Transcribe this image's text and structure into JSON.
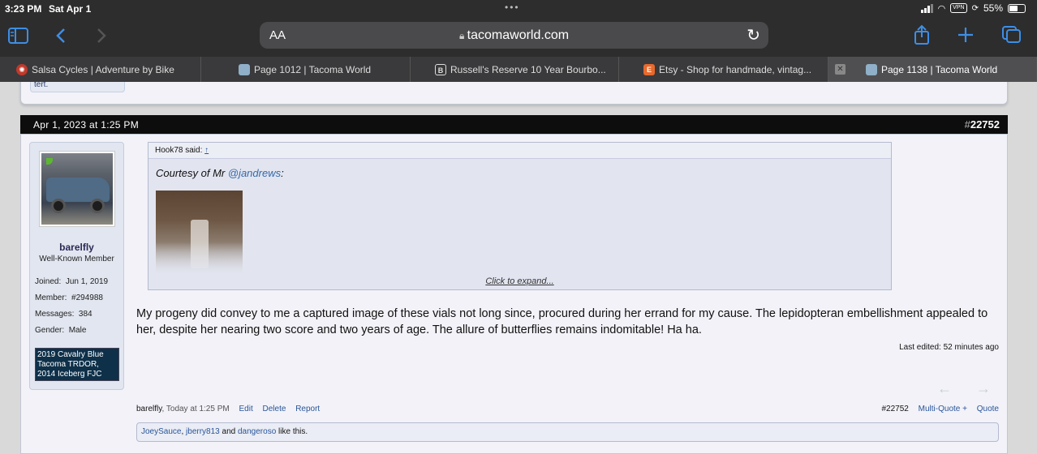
{
  "status_bar": {
    "time": "3:23 PM",
    "date": "Sat Apr 1",
    "vpn": "VPN",
    "battery": "55%",
    "battery_level": 0.55
  },
  "browser": {
    "text_size_label": "AA",
    "url": "tacomaworld.com",
    "accent": "#3d8ee6"
  },
  "tabs": [
    {
      "title": "Salsa Cycles | Adventure by Bike",
      "icon": "salsa-favicon",
      "color": "#c0392b"
    },
    {
      "title": "Page 1012 | Tacoma World",
      "icon": "tacomaworld-favicon",
      "color": "#3a7d3a"
    },
    {
      "title": "Russell's Reserve 10 Year Bourbo...",
      "icon": "b-favicon",
      "color": "#444444",
      "glyph": "B"
    },
    {
      "title": "Etsy - Shop for handmade, vintag...",
      "icon": "etsy-favicon",
      "color": "#e8692c",
      "glyph": "E"
    },
    {
      "title": "Page 1138 | Tacoma World",
      "icon": "tacomaworld-favicon",
      "color": "#3a7d3a",
      "active": true
    }
  ],
  "prev_post": {
    "signature_stub": "tert."
  },
  "post": {
    "date": "Apr 1, 2023 at 1:25 PM",
    "number_prefix": "#",
    "number": "22752",
    "user": {
      "name": "barelfly",
      "title": "Well-Known Member",
      "stats": [
        {
          "label": "Joined:",
          "value": "Jun 1, 2019"
        },
        {
          "label": "Member:",
          "value": "#294988"
        },
        {
          "label": "Messages:",
          "value": "384"
        },
        {
          "label": "Gender:",
          "value": "Male"
        }
      ],
      "signature": "2019 Cavalry Blue Tacoma TRDOR, 2014 Iceberg FJC"
    },
    "quote": {
      "author_said": "Hook78 said:",
      "up_link": "↑",
      "text_prefix": "Courtesy of Mr ",
      "mention": "@jandrews",
      "text_suffix": ":",
      "expand_label": "Click to expand..."
    },
    "message": "My progeny did convey to me a captured image of these vials not long since, procured during her errand for my cause. The lepidopteran embellishment appealed to her, despite her nearing two score and two years of age. The allure of butterflies remains indomitable! Ha ha.",
    "last_edited": "Last edited: 52 minutes ago",
    "footer": {
      "author": "barelfly",
      "timestamp": ", Today at 1:25 PM",
      "edit": "Edit",
      "delete": "Delete",
      "report": "Report",
      "post_number": "#22752",
      "multi_quote": "Multi-Quote +",
      "quote": "Quote"
    },
    "likes": {
      "user1": "JoeySauce",
      "sep1": ", ",
      "user2": "jberry813",
      "sep2": " and ",
      "user3": "dangeroso",
      "suffix": " like this."
    }
  }
}
